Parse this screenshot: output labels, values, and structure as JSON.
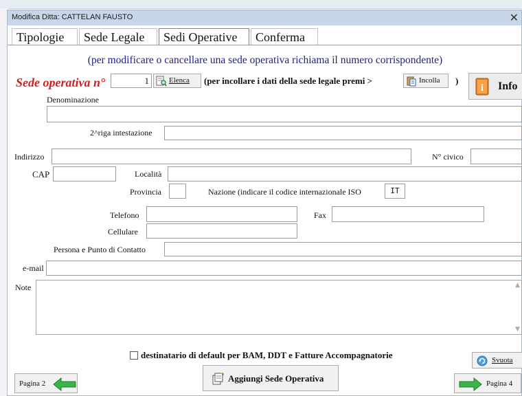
{
  "window": {
    "title": "Modifica Ditta: CATTELAN FAUSTO",
    "close": "✕"
  },
  "tabs": [
    {
      "label": "Tipologie"
    },
    {
      "label": "Sede Legale"
    },
    {
      "label": "Sedi Operative"
    },
    {
      "label": "Conferma"
    }
  ],
  "instructions": "(per modificare o cancellare una sede operativa richiama il numero corrispondente)",
  "sede": {
    "label": "Sede operativa n°",
    "numero": "1",
    "elenca_label": "Elenca",
    "paste_hint": "(per incollare i dati della sede legale premi >",
    "incolla_label": "Incolla",
    "paren_close": ")",
    "info_label": "Info"
  },
  "fields": {
    "denominazione": {
      "label": "Denominazione",
      "value": ""
    },
    "seconda_riga": {
      "label": "2^riga intestazione",
      "value": ""
    },
    "indirizzo": {
      "label": "Indirizzo",
      "value": ""
    },
    "civico": {
      "label": "N° civico",
      "value": ""
    },
    "cap": {
      "label": "CAP",
      "value": ""
    },
    "localita": {
      "label": "Località",
      "value": ""
    },
    "provincia": {
      "label": "Provincia",
      "value": ""
    },
    "nazione": {
      "label": "Nazione (indicare il codice internazionale ISO",
      "value": "IT"
    },
    "telefono": {
      "label": "Telefono",
      "value": ""
    },
    "fax": {
      "label": "Fax",
      "value": ""
    },
    "cellulare": {
      "label": "Cellulare",
      "value": ""
    },
    "contatto": {
      "label": "Persona e Punto di Contatto",
      "value": ""
    },
    "email": {
      "label": "e-mail",
      "value": ""
    },
    "note": {
      "label": "Note",
      "value": ""
    }
  },
  "checkbox": {
    "label": "destinatario di default per BAM, DDT e Fatture Accompagnatorie",
    "checked": false
  },
  "buttons": {
    "svuota": "Svuota",
    "pagina2": "Pagina 2",
    "aggiungi": "Aggiungi Sede Operativa",
    "pagina4": "Pagina 4"
  },
  "colors": {
    "accent_red": "#d21f1f",
    "instruction_blue": "#21208a",
    "arrow_green": "#3bb54a",
    "titlebar": "#c8d6ea"
  }
}
